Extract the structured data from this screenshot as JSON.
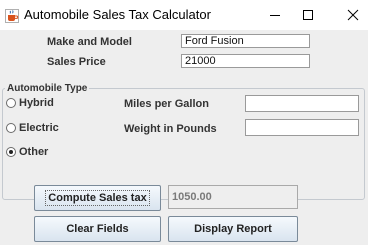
{
  "window": {
    "title": "Automobile Sales Tax Calculator",
    "icon": "java-cup-icon",
    "minimize_glyph": "—",
    "maximize_glyph": "☐",
    "close_glyph": "✕"
  },
  "form": {
    "make_model_label": "Make and Model",
    "make_model_value": "Ford Fusion",
    "sales_price_label": "Sales Price",
    "sales_price_value": "21000"
  },
  "automobile_type": {
    "group_title": "Automobile Type",
    "options": [
      {
        "label": "Hybrid",
        "checked": false
      },
      {
        "label": "Electric",
        "checked": false
      },
      {
        "label": "Other",
        "checked": true
      }
    ],
    "mpg_label": "Miles per Gallon",
    "mpg_value": "",
    "weight_label": "Weight in Pounds",
    "weight_value": ""
  },
  "actions": {
    "compute_label": "Compute Sales tax",
    "result_value": "1050.00",
    "clear_label": "Clear Fields",
    "report_label": "Display Report"
  }
}
